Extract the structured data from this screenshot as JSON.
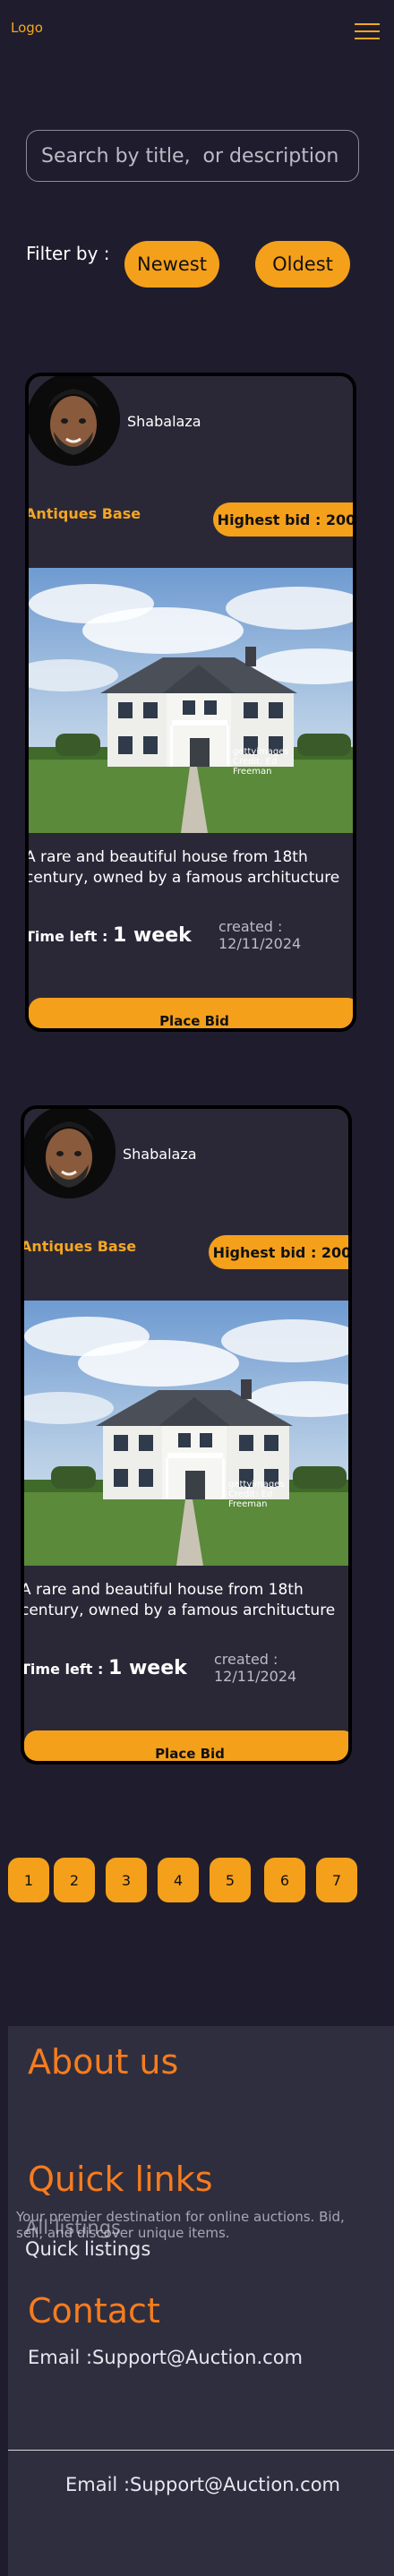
{
  "header": {
    "logo": "Logo"
  },
  "search": {
    "placeholder": "Search by title,  or description"
  },
  "filter": {
    "label": "Filter by :",
    "newest": "Newest",
    "oldest": "Oldest"
  },
  "listings": [
    {
      "seller": "Shabalaza",
      "shop": "Antiques Base",
      "highest_bid": "Highest bid : 200",
      "description": "A rare and beautiful house from 18th century, owned by a famous architucture",
      "time_left_label": "Time left :",
      "time_left_value": "1 week",
      "created": "created : 12/11/2024",
      "cta": "Place Bid",
      "watermark": "gettyimages Credit: Ed Freeman"
    },
    {
      "seller": "Shabalaza",
      "shop": "Antiques Base",
      "highest_bid": "Highest bid : 200",
      "description": "A rare and beautiful house from 18th century, owned by a famous architucture",
      "time_left_label": "Time left :",
      "time_left_value": "1 week",
      "created": "created : 12/11/2024",
      "cta": "Place Bid",
      "watermark": "gettyimages Credit: Ed Freeman"
    }
  ],
  "pagination": [
    "1",
    "2",
    "3",
    "4",
    "5",
    "6",
    "7"
  ],
  "footer": {
    "about_title": "About us",
    "about_text": "Your premier destination for online auctions. Bid, sell, and discover unique items.",
    "quick_title": "Quick links",
    "link_all": "All listings",
    "link_quick": "Quick listings",
    "contact_title": "Contact",
    "email": "Email :Support@Auction.com",
    "bottom_email": "Email :Support@Auction.com"
  },
  "colors": {
    "accent": "#f5a01b",
    "background": "#1f1d2d",
    "card": "#2a2837",
    "footer_heading": "#f57c1f"
  }
}
